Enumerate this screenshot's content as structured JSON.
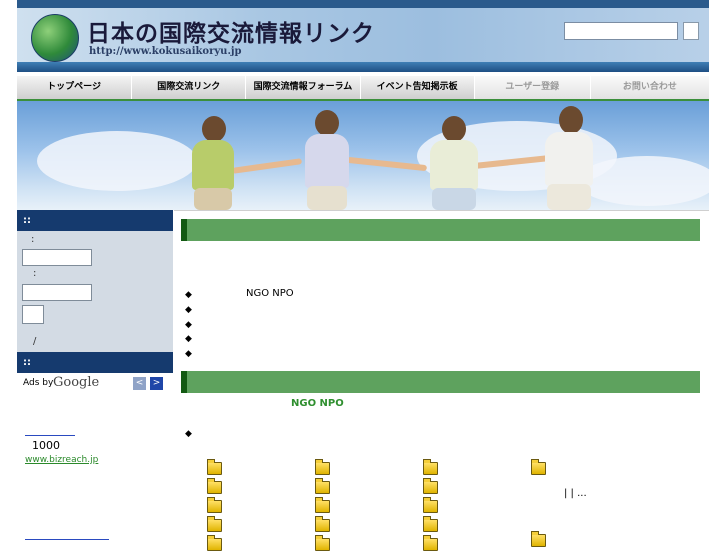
{
  "header": {
    "logo_title": "日本の国際交流情報リンク",
    "logo_url": "http://www.kokusaikoryu.jp",
    "search_value": ""
  },
  "nav": {
    "items": [
      {
        "label": "トップページ",
        "enabled": true
      },
      {
        "label": "国際交流リンク",
        "enabled": true
      },
      {
        "label": "国際交流情報フォーラム",
        "enabled": true
      },
      {
        "label": "イベント告知掲示板",
        "enabled": true
      },
      {
        "label": "ユーザー登録",
        "enabled": false
      },
      {
        "label": "お問い合わせ",
        "enabled": false
      }
    ]
  },
  "sidebar": {
    "login_header": "::",
    "id_label": ":",
    "password_label": ":",
    "id_value": "",
    "password_value": "",
    "bottom_text": "/",
    "ads_header": "::",
    "ads_by": "Ads by",
    "ads_google": "Google",
    "ad_prev": "<",
    "ad_next": ">",
    "ad_number": "1000",
    "ad_url": "www.bizreach.jp"
  },
  "main": {
    "section1": {
      "bullet": "◆",
      "items": [
        "NGO NPO",
        "",
        "",
        "",
        ""
      ]
    },
    "section2": {
      "green_text": "NGO  NPO",
      "bullet": "◆",
      "side_text": "|    |  ..."
    }
  }
}
